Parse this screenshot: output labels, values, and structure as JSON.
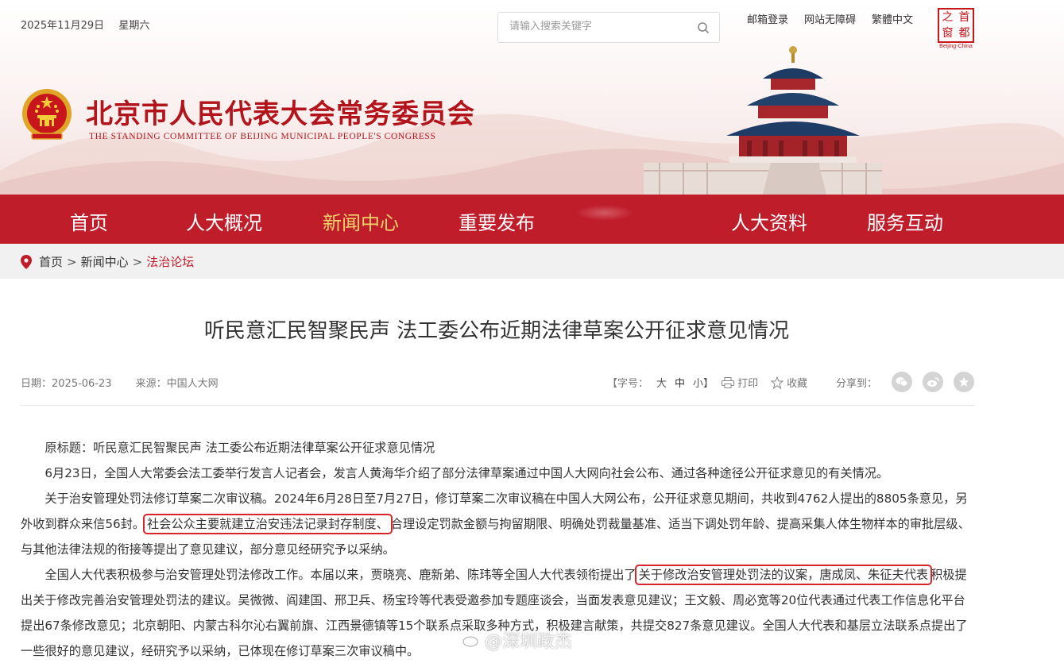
{
  "header": {
    "date": "2025年11月29日",
    "weekday": "星期六",
    "search_placeholder": "请输入搜索关键字",
    "links": [
      "邮箱登录",
      "网站无障碍",
      "繁體中文"
    ],
    "capital_logo_chars": [
      "之",
      "首",
      "窗",
      "都"
    ],
    "capital_logo_caption": "Beijing-China",
    "site_title": "北京市人民代表大会常务委员会",
    "site_subtitle": "THE STANDING COMMITTEE OF BEIJING MUNICIPAL PEOPLE'S CONGRESS"
  },
  "nav": {
    "items": [
      "首页",
      "人大概况",
      "新闻中心",
      "重要发布",
      "人大资料",
      "服务互动"
    ],
    "active_index": 2
  },
  "breadcrumb": {
    "items": [
      "首页",
      "新闻中心",
      "法治论坛"
    ],
    "separator": ">"
  },
  "article": {
    "title": "听民意汇民智聚民声 法工委公布近期法律草案公开征求意见情况",
    "date": "日期：2025-06-23",
    "source": "来源：中国人大网",
    "font_size_label": "【字号：",
    "font_sizes": [
      "大",
      "中",
      "小】"
    ],
    "print_label": "打印",
    "favorite_label": "收藏",
    "share_label": "分享到：",
    "paragraphs": {
      "p1": "原标题：听民意汇民智聚民声 法工委公布近期法律草案公开征求意见情况",
      "p2": "6月23日，全国人大常委会法工委举行发言人记者会，发言人黄海华介绍了部分法律草案通过中国人大网向社会公布、通过各种途径公开征求意见的有关情况。",
      "p3_a": "关于治安管理处罚法修订草案二次审议稿。2024年6月28日至7月27日，修订草案二次审议稿在中国人大网公布，公开征求意见期间，共收到4762人提出的8805条意见，另外收到群众来信56封。",
      "p3_hl": "社会公众主要就建立治安违法记录封存制度、",
      "p3_b": "合理设定罚款金额与拘留期限、明确处罚裁量基准、适当下调处罚年龄、提高采集人体生物样本的审批层级、与其他法律法规的衔接等提出了意见建议，部分意见经研究予以采纳。",
      "p4_a": "全国人大代表积极参与治安管理处罚法修改工作。本届以来，贾晓亮、鹿新弟、陈玮等全国人大代表领衔提出了",
      "p4_hl": "关于修改治安管理处罚法的议案，唐成凤、朱征夫代表",
      "p4_b": "积极提出关于修改完善治安管理处罚法的建议。吴微微、阎建国、邢卫兵、杨宝玲等代表受邀参加专题座谈会，当面发表意见建议；王文毅、周必宽等20位代表通过代表工作信息化平台提出67条修改意见；北京朝阳、内蒙古科尔沁右翼前旗、江西景德镇等15个联系点采取多种方式，积极建言献策，共提交827条意见建议。全国人大代表和基层立法联系点提出了一些很好的意见建议，经研究予以采纳，已体现在修订草案三次审议稿中。"
    }
  },
  "watermark": "@深圳政杰",
  "colors": {
    "brand_red": "#c01d2b",
    "nav_active": "#f7d26b",
    "highlight_box": "#d6252d"
  }
}
